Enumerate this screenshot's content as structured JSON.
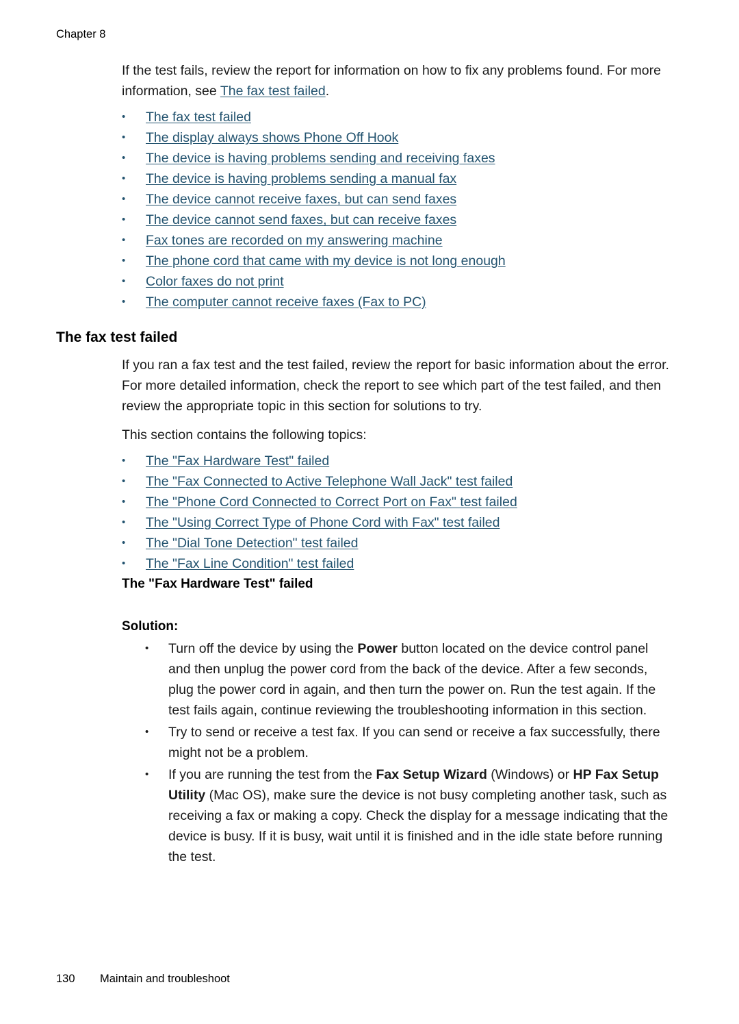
{
  "page": {
    "running_head": "Chapter 8",
    "footer_page_number": "130",
    "footer_section": "Maintain and troubleshoot",
    "link_color": "#23536f",
    "text_color": "#1a1a1a",
    "background": "#ffffff"
  },
  "intro": {
    "paragraph_before_link": "If the test fails, review the report for information on how to fix any problems found. For more information, see ",
    "inline_link": "The fax test failed",
    "paragraph_after_link": ".",
    "links": [
      "The fax test failed",
      "The display always shows Phone Off Hook",
      "The device is having problems sending and receiving faxes",
      "The device is having problems sending a manual fax",
      "The device cannot receive faxes, but can send faxes",
      "The device cannot send faxes, but can receive faxes",
      "Fax tones are recorded on my answering machine",
      "The phone cord that came with my device is not long enough",
      "Color faxes do not print",
      "The computer cannot receive faxes (Fax to PC)"
    ]
  },
  "section": {
    "title": "The fax test failed",
    "paragraph_1": "If you ran a fax test and the test failed, review the report for basic information about the error. For more detailed information, check the report to see which part of the test failed, and then review the appropriate topic in this section for solutions to try.",
    "paragraph_2": "This section contains the following topics:",
    "topic_links": [
      "The \"Fax Hardware Test\" failed",
      "The \"Fax Connected to Active Telephone Wall Jack\" test failed",
      "The \"Phone Cord Connected to Correct Port on Fax\" test failed",
      "The \"Using Correct Type of Phone Cord with Fax\" test failed",
      "The \"Dial Tone Detection\" test failed",
      "The \"Fax Line Condition\" test failed"
    ]
  },
  "subsection": {
    "title": "The \"Fax Hardware Test\" failed",
    "solution_label": "Solution:",
    "bullet_1": {
      "part_1": "Turn off the device by using the ",
      "bold_1": "Power",
      "part_2": " button located on the device control panel and then unplug the power cord from the back of the device. After a few seconds, plug the power cord in again, and then turn the power on. Run the test again. If the test fails again, continue reviewing the troubleshooting information in this section."
    },
    "bullet_2": {
      "text": "Try to send or receive a test fax. If you can send or receive a fax successfully, there might not be a problem."
    },
    "bullet_3": {
      "part_1": "If you are running the test from the ",
      "bold_1": "Fax Setup Wizard",
      "part_2": " (Windows) or ",
      "bold_2": "HP Fax Setup Utility",
      "part_3": " (Mac OS), make sure the device is not busy completing another task, such as receiving a fax or making a copy. Check the display for a message indicating that the device is busy. If it is busy, wait until it is finished and in the idle state before running the test."
    }
  }
}
